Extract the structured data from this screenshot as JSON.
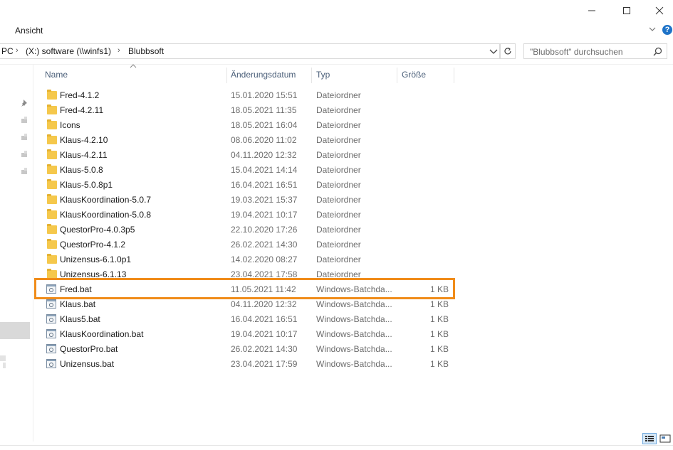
{
  "window": {
    "minimize_icon": "minimize-icon",
    "maximize_icon": "maximize-icon",
    "close_icon": "close-icon"
  },
  "ribbon": {
    "tab_view": "Ansicht",
    "help": "?"
  },
  "address": {
    "crumbs": [
      "PC",
      "(X:) software (\\\\winfs1)",
      "Blubbsoft"
    ]
  },
  "search": {
    "placeholder": "\"Blubbsoft\" durchsuchen"
  },
  "columns": {
    "name": "Name",
    "date": "Änderungsdatum",
    "type": "Typ",
    "size": "Größe"
  },
  "files": [
    {
      "name": "Fred-4.1.2",
      "date": "15.01.2020 15:51",
      "type": "Dateiordner",
      "size": "",
      "kind": "folder"
    },
    {
      "name": "Fred-4.2.11",
      "date": "18.05.2021 11:35",
      "type": "Dateiordner",
      "size": "",
      "kind": "folder"
    },
    {
      "name": "Icons",
      "date": "18.05.2021 16:04",
      "type": "Dateiordner",
      "size": "",
      "kind": "folder"
    },
    {
      "name": "Klaus-4.2.10",
      "date": "08.06.2020 11:02",
      "type": "Dateiordner",
      "size": "",
      "kind": "folder"
    },
    {
      "name": "Klaus-4.2.11",
      "date": "04.11.2020 12:32",
      "type": "Dateiordner",
      "size": "",
      "kind": "folder"
    },
    {
      "name": "Klaus-5.0.8",
      "date": "15.04.2021 14:14",
      "type": "Dateiordner",
      "size": "",
      "kind": "folder"
    },
    {
      "name": "Klaus-5.0.8p1",
      "date": "16.04.2021 16:51",
      "type": "Dateiordner",
      "size": "",
      "kind": "folder"
    },
    {
      "name": "KlausKoordination-5.0.7",
      "date": "19.03.2021 15:37",
      "type": "Dateiordner",
      "size": "",
      "kind": "folder"
    },
    {
      "name": "KlausKoordination-5.0.8",
      "date": "19.04.2021 10:17",
      "type": "Dateiordner",
      "size": "",
      "kind": "folder"
    },
    {
      "name": "QuestorPro-4.0.3p5",
      "date": "22.10.2020 17:26",
      "type": "Dateiordner",
      "size": "",
      "kind": "folder"
    },
    {
      "name": "QuestorPro-4.1.2",
      "date": "26.02.2021 14:30",
      "type": "Dateiordner",
      "size": "",
      "kind": "folder"
    },
    {
      "name": "Unizensus-6.1.0p1",
      "date": "14.02.2020 08:27",
      "type": "Dateiordner",
      "size": "",
      "kind": "folder"
    },
    {
      "name": "Unizensus-6.1.13",
      "date": "23.04.2021 17:58",
      "type": "Dateiordner",
      "size": "",
      "kind": "folder"
    },
    {
      "name": "Fred.bat",
      "date": "11.05.2021 11:42",
      "type": "Windows-Batchda...",
      "size": "1 KB",
      "kind": "bat"
    },
    {
      "name": "Klaus.bat",
      "date": "04.11.2020 12:32",
      "type": "Windows-Batchda...",
      "size": "1 KB",
      "kind": "bat"
    },
    {
      "name": "Klaus5.bat",
      "date": "16.04.2021 16:51",
      "type": "Windows-Batchda...",
      "size": "1 KB",
      "kind": "bat"
    },
    {
      "name": "KlausKoordination.bat",
      "date": "19.04.2021 10:17",
      "type": "Windows-Batchda...",
      "size": "1 KB",
      "kind": "bat"
    },
    {
      "name": "QuestorPro.bat",
      "date": "26.02.2021 14:30",
      "type": "Windows-Batchda...",
      "size": "1 KB",
      "kind": "bat"
    },
    {
      "name": "Unizensus.bat",
      "date": "23.04.2021 17:59",
      "type": "Windows-Batchda...",
      "size": "1 KB",
      "kind": "bat"
    }
  ],
  "highlight_color": "#f08c1a"
}
